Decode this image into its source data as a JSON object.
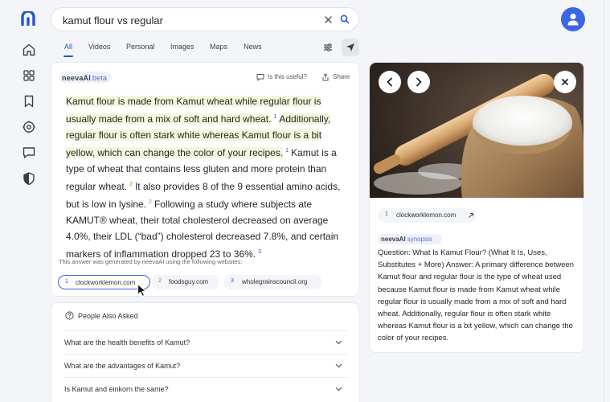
{
  "search": {
    "query": "kamut flour vs regular"
  },
  "tabs": [
    {
      "label": "All"
    },
    {
      "label": "Videos"
    },
    {
      "label": "Personal"
    },
    {
      "label": "Images"
    },
    {
      "label": "Maps"
    },
    {
      "label": "News"
    }
  ],
  "rail": {
    "icons": [
      "home-icon",
      "grid-icon",
      "bookmark-icon",
      "settings-icon",
      "chat-icon",
      "shield-icon"
    ]
  },
  "answer": {
    "brand": "neevaAI",
    "badge": "beta",
    "useful_label": "Is this useful?",
    "share_label": "Share",
    "parts": {
      "p1": "Kamut flour is made from Kamut wheat while regular flour is usually made from a mix of soft and hard wheat.",
      "r1": "1",
      "p2": "Additionally, regular flour is often stark white whereas Kamut flour is a bit yellow, which can change the color of your recipes.",
      "r2": "1",
      "p3": "Kamut is a type of wheat that contains less gluten and more protein than regular wheat.",
      "r3": "2",
      "p4": "It also provides 8 of the 9 essential amino acids, but is low in lysine.",
      "r4": "2",
      "p5": "Following a study where subjects ate KAMUT® wheat, their total cholesterol decreased on average 4.0%, their LDL (“bad”) cholesterol decreased 7.8%, and certain markers of inflammation dropped 23 to 36%.",
      "r5": "3"
    },
    "generated_note": "This answer was generated by neevaAI using the following websites:",
    "sources": [
      {
        "num": "1",
        "domain": "clockworklemon.com"
      },
      {
        "num": "2",
        "domain": "foodsguy.com"
      },
      {
        "num": "3",
        "domain": "wholegrainscouncil.org"
      }
    ]
  },
  "paa": {
    "title": "People Also Asked",
    "questions": [
      "What are the health benefits of Kamut?",
      "What are the advantages of Kamut?",
      "Is Kamut and einkorn the same?"
    ]
  },
  "side": {
    "source": {
      "num": "1",
      "domain": "clockworklemon.com"
    },
    "brand": "neevaAI",
    "badge": "synopsis",
    "synopsis": "Question: What Is Kamut Flour? (What It Is, Uses, Substitutes + More) Answer: A primary difference between Kamut flour and regular flour is the type of wheat used because Kamut flour is made from Kamut wheat while regular flour is usually made from a mix of soft and hard wheat. Additionally, regular flour is often stark white whereas Kamut flour is a bit yellow, which can change the color of your recipes."
  },
  "colors": {
    "accent": "#2553d6",
    "highlight": "#f2f8dc",
    "avatar": "#3b66e6",
    "citation_orange": "#c67f1f"
  }
}
